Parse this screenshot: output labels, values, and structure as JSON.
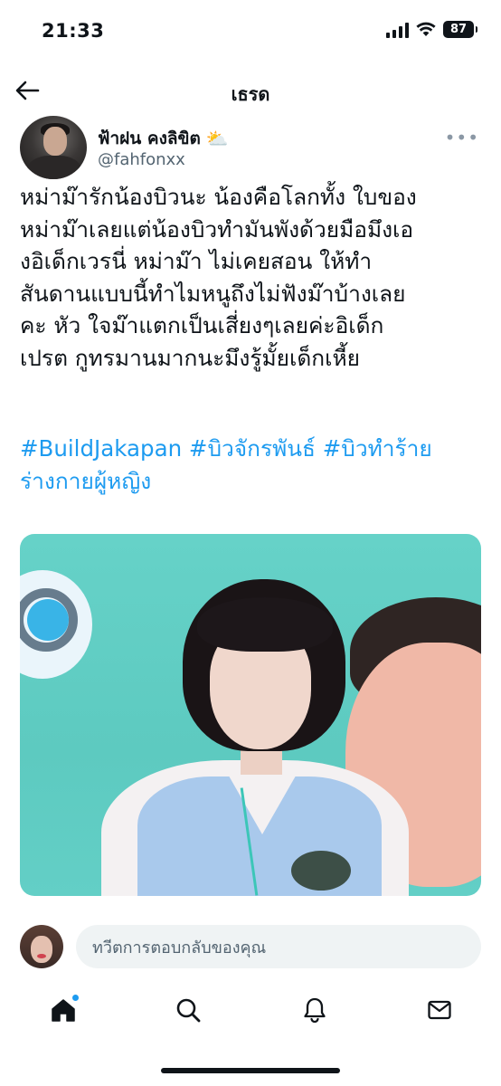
{
  "status_bar": {
    "time": "21:33",
    "battery": "87",
    "icons": [
      "cellular-signal-icon",
      "wifi-icon",
      "battery-icon"
    ]
  },
  "header": {
    "back_icon": "arrow-left-icon",
    "title": "เธรด"
  },
  "author": {
    "name": "ฟ้าฝน คงลิขิต",
    "name_emoji": "⛅",
    "handle": "@fahfonxx",
    "more_label": "•••"
  },
  "tweet": {
    "lines": [
      "หม่าม๊ารักน้องบิวนะ น้องคือโลกทั้ง ใบของ",
      "หม่าม๊าเลยแต่น้องบิวทำมันพังด้วยมือมึงเอ",
      "งอิเด็กเวรนี่ หม่าม๊า ไม่เคยสอน ให้ทำ",
      "สันดานแบบนี้ทำไมหนูถึงไม่ฟังม๊าบ้างเลย",
      "คะ หัว ใจม๊าแตกเป็นเสี่ยงๆเลยค่ะอิเด็ก",
      "เปรต กูทรมานมากนะมึงรู้มั้ยเด็กเหี้ย"
    ],
    "hashtag_lines": [
      "#BuildJakapan #บิวจักรพันธ์ #บิวทำร้าย",
      "ร่างกายผู้หญิง"
    ]
  },
  "reply": {
    "placeholder": "ทวีตการตอบกลับของคุณ"
  },
  "bottom_nav": {
    "items": [
      "home-icon",
      "search-icon",
      "notifications-icon",
      "messages-icon"
    ],
    "accent_color": "#1d9bf0"
  },
  "colors": {
    "hashtag": "#1d9bf0",
    "text": "#0f1419",
    "secondary": "#536471"
  }
}
